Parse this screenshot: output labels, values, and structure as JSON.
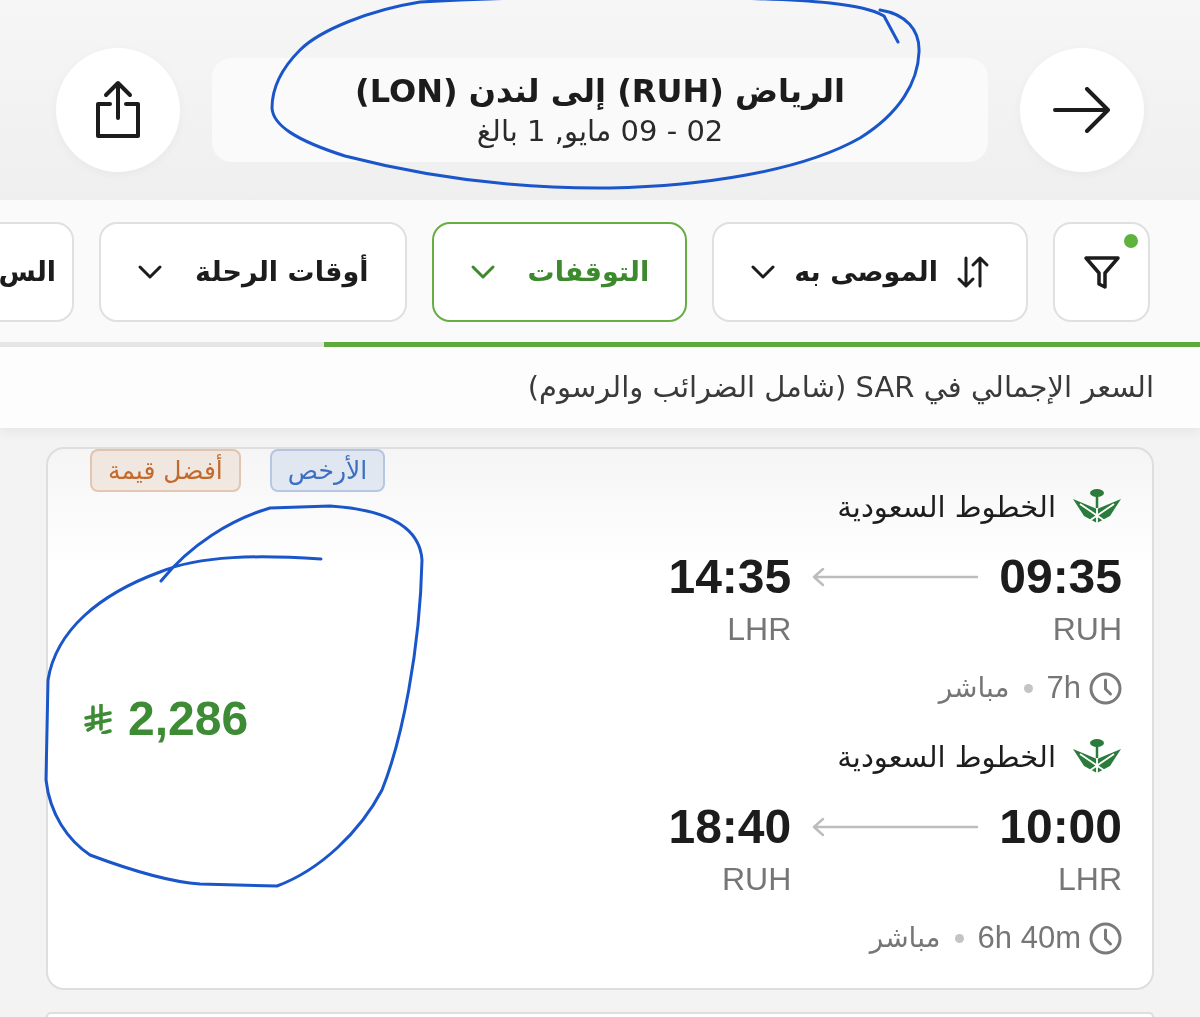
{
  "header": {
    "title": "الرياض (RUH) إلى لندن (LON)",
    "subtitle": "02 - 09 مايو, 1 بالغ"
  },
  "filters": {
    "filter_button": {
      "active": true
    },
    "chips": [
      {
        "label": "الموصى به",
        "kind": "sort",
        "selected": false
      },
      {
        "label": "التوقفات",
        "kind": "dropdown",
        "selected": true
      },
      {
        "label": "أوقات الرحلة",
        "kind": "dropdown",
        "selected": false
      },
      {
        "label": "الس",
        "kind": "partial",
        "selected": false
      }
    ]
  },
  "loading_bar": {
    "level": 0.73
  },
  "price_note": "السعر الإجمالي في SAR (شامل الضرائب والرسوم)",
  "results": [
    {
      "badges": [
        {
          "label": "الأرخص",
          "color": "#3b6fc2"
        },
        {
          "label": "أفضل قيمة",
          "color": "#c2692b"
        }
      ],
      "price": "2,286",
      "legs": [
        {
          "airline": "الخطوط السعودية",
          "depart_time": "09:35",
          "depart_airport": "RUH",
          "arrive_time": "14:35",
          "arrive_airport": "LHR",
          "duration": "7h",
          "stops": "مباشر"
        },
        {
          "airline": "الخطوط السعودية",
          "depart_time": "10:00",
          "depart_airport": "LHR",
          "arrive_time": "18:40",
          "arrive_airport": "RUH",
          "duration": "6h 40m",
          "stops": "مباشر"
        }
      ]
    }
  ]
}
